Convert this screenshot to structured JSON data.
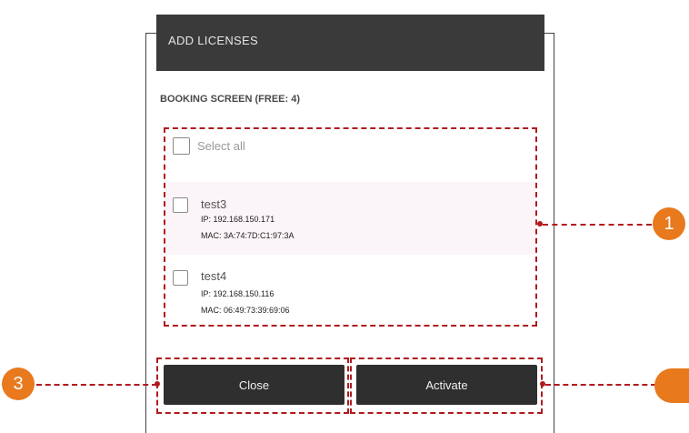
{
  "dialog": {
    "title": "ADD LICENSES",
    "section_label": "BOOKING SCREEN (FREE: 4)",
    "select_all_label": "Select all"
  },
  "devices": [
    {
      "name": "test3",
      "ip": "IP: 192.168.150.171",
      "mac": "MAC: 3A:74:7D:C1:97:3A",
      "highlighted": true
    },
    {
      "name": "test4",
      "ip": "IP: 192.168.150.116",
      "mac": "MAC: 06:49:73:39:69:06",
      "highlighted": false
    }
  ],
  "buttons": {
    "close_label": "Close",
    "activate_label": "Activate"
  },
  "callouts": {
    "list_badge": "1",
    "close_badge": "3",
    "activate_badge": ""
  },
  "colors": {
    "header_bg": "#3a3a3a",
    "button_bg": "#2f2f2f",
    "callout_dash": "#b01a1f",
    "badge": "#e8791d"
  }
}
